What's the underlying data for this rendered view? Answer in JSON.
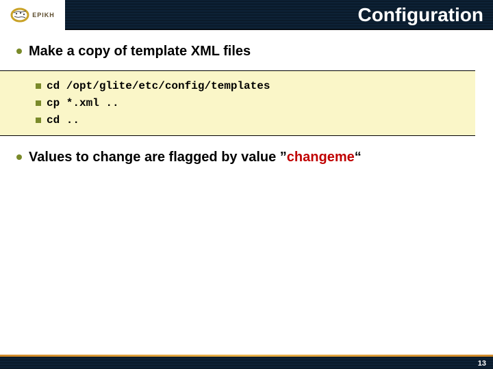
{
  "header": {
    "logo_text": "EPIKH",
    "title": "Configuration"
  },
  "bullets": [
    {
      "text": "Make a copy of template XML files"
    }
  ],
  "code": {
    "lines": [
      "cd /opt/glite/etc/config/templates",
      "cp *.xml ..",
      "cd .."
    ]
  },
  "bullet2_prefix": "Values to change are flagged by value ”",
  "bullet2_highlight": "changeme",
  "bullet2_suffix": "“",
  "footer": {
    "page": "13"
  }
}
